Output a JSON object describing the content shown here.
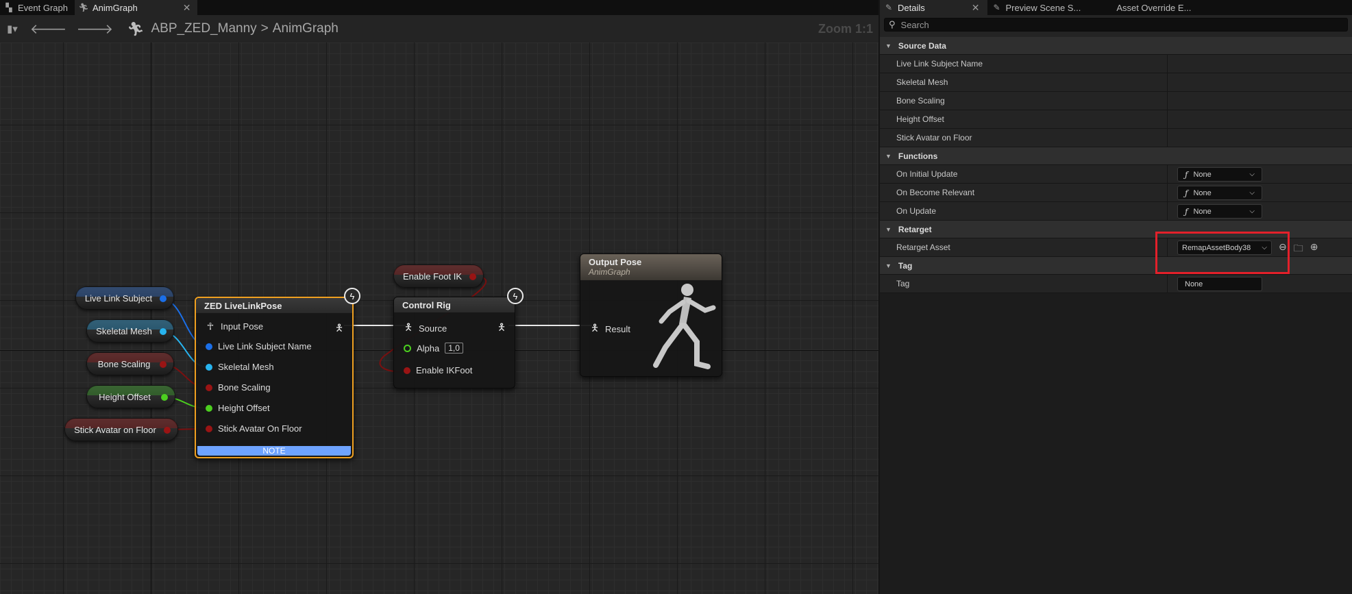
{
  "graph_tabs": [
    {
      "label": "Event Graph",
      "icon": "event-graph-icon"
    },
    {
      "label": "AnimGraph",
      "icon": "anim-graph-icon",
      "close": "✕"
    }
  ],
  "toolbar": {
    "breadcrumb_root": "ABP_ZED_Manny",
    "breadcrumb_separator": ">",
    "breadcrumb_current": "AnimGraph",
    "zoom": "Zoom 1:1"
  },
  "variables": {
    "live_link_subject": "Live Link Subject",
    "skeletal_mesh": "Skeletal Mesh",
    "bone_scaling": "Bone Scaling",
    "height_offset": "Height Offset",
    "stick_avatar": "Stick Avatar on Floor",
    "enable_foot_ik": "Enable Foot IK"
  },
  "zed_node": {
    "title": "ZED LiveLinkPose",
    "pins": [
      "Input Pose",
      "Live Link Subject Name",
      "Skeletal Mesh",
      "Bone Scaling",
      "Height Offset",
      "Stick Avatar On Floor"
    ],
    "note": "NOTE"
  },
  "control_rig_node": {
    "title": "Control Rig",
    "source": "Source",
    "alpha_label": "Alpha",
    "alpha_value": "1,0",
    "enable_ikfoot": "Enable IKFoot"
  },
  "output_node": {
    "title": "Output Pose",
    "subtitle": "AnimGraph",
    "result": "Result"
  },
  "pin_colors": {
    "subject": "#1b6fe8",
    "mesh": "#28b4ef",
    "float": "#9a1414",
    "bool": "#9a1414",
    "height": "#4ccf1f"
  },
  "details_tabs": [
    {
      "label": "Details",
      "close": "✕"
    },
    {
      "label": "Preview Scene S..."
    },
    {
      "label": "Asset Override E..."
    }
  ],
  "search": {
    "placeholder": "Search"
  },
  "sections": {
    "source_data": {
      "title": "Source Data",
      "props": [
        "Live Link Subject Name",
        "Skeletal Mesh",
        "Bone Scaling",
        "Height Offset",
        "Stick Avatar on Floor"
      ]
    },
    "functions": {
      "title": "Functions",
      "props": [
        {
          "name": "On Initial Update",
          "value": "None"
        },
        {
          "name": "On Become Relevant",
          "value": "None"
        },
        {
          "name": "On Update",
          "value": "None"
        }
      ]
    },
    "retarget": {
      "title": "Retarget",
      "prop": {
        "name": "Retarget Asset",
        "value": "RemapAssetBody38"
      }
    },
    "tag": {
      "title": "Tag",
      "prop": {
        "name": "Tag",
        "value": "None"
      }
    }
  },
  "highlight_color": "#e3202a"
}
